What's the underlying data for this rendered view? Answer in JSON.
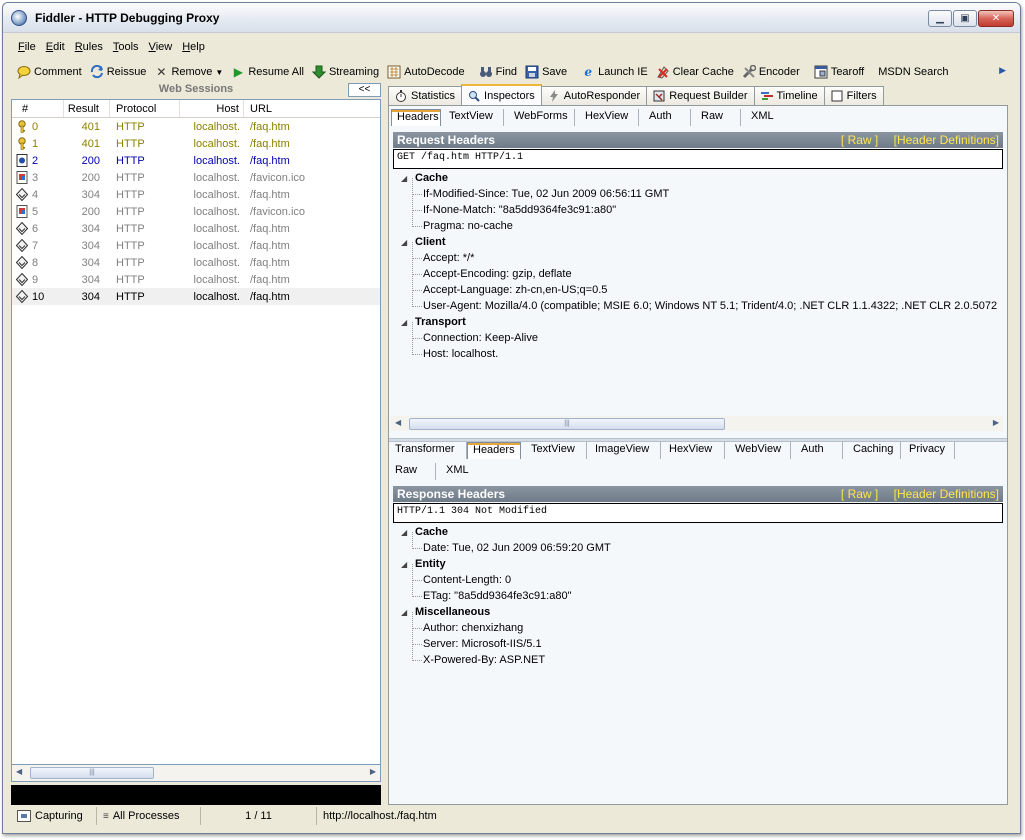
{
  "window": {
    "title": "Fiddler - HTTP Debugging Proxy"
  },
  "menu": [
    {
      "letter": "F",
      "rest": "ile"
    },
    {
      "letter": "E",
      "rest": "dit"
    },
    {
      "letter": "R",
      "rest": "ules"
    },
    {
      "letter": "T",
      "rest": "ools"
    },
    {
      "letter": "V",
      "rest": "iew"
    },
    {
      "letter": "H",
      "rest": "elp"
    }
  ],
  "toolbar": {
    "comment": "Comment",
    "reissue": "Reissue",
    "remove": "Remove",
    "resume_all": "Resume All",
    "streaming": "Streaming",
    "autodecode": "AutoDecode",
    "find": "Find",
    "save": "Save",
    "launch_ie": "Launch IE",
    "clear_cache": "Clear Cache",
    "encoder": "Encoder",
    "tearoff": "Tearoff",
    "msdn_search": "MSDN Search"
  },
  "sessions": {
    "title": "Web Sessions",
    "collapse_label": "<<",
    "columns": {
      "num": "#",
      "result": "Result",
      "protocol": "Protocol",
      "host": "Host",
      "url": "URL"
    },
    "rows": [
      {
        "num": "0",
        "result": "401",
        "protocol": "HTTP",
        "host": "localhost.",
        "url": "/faq.htm",
        "icon": "key-icon",
        "color": "#8b8000"
      },
      {
        "num": "1",
        "result": "401",
        "protocol": "HTTP",
        "host": "localhost.",
        "url": "/faq.htm",
        "icon": "key-icon",
        "color": "#8b8000"
      },
      {
        "num": "2",
        "result": "200",
        "protocol": "HTTP",
        "host": "localhost.",
        "url": "/faq.htm",
        "icon": "page-icon",
        "color": "#0000b0"
      },
      {
        "num": "3",
        "result": "200",
        "protocol": "HTTP",
        "host": "localhost.",
        "url": "/favicon.ico",
        "icon": "image-icon",
        "color": "#808080"
      },
      {
        "num": "4",
        "result": "304",
        "protocol": "HTTP",
        "host": "localhost.",
        "url": "/faq.htm",
        "icon": "diamond-icon",
        "color": "#808080"
      },
      {
        "num": "5",
        "result": "200",
        "protocol": "HTTP",
        "host": "localhost.",
        "url": "/favicon.ico",
        "icon": "image-icon",
        "color": "#808080"
      },
      {
        "num": "6",
        "result": "304",
        "protocol": "HTTP",
        "host": "localhost.",
        "url": "/faq.htm",
        "icon": "diamond-icon",
        "color": "#808080"
      },
      {
        "num": "7",
        "result": "304",
        "protocol": "HTTP",
        "host": "localhost.",
        "url": "/faq.htm",
        "icon": "diamond-icon",
        "color": "#808080"
      },
      {
        "num": "8",
        "result": "304",
        "protocol": "HTTP",
        "host": "localhost.",
        "url": "/faq.htm",
        "icon": "diamond-icon",
        "color": "#808080"
      },
      {
        "num": "9",
        "result": "304",
        "protocol": "HTTP",
        "host": "localhost.",
        "url": "/faq.htm",
        "icon": "diamond-icon",
        "color": "#808080"
      },
      {
        "num": "10",
        "result": "304",
        "protocol": "HTTP",
        "host": "localhost.",
        "url": "/faq.htm",
        "icon": "diamond-icon",
        "color": "#000000",
        "selected": true
      }
    ]
  },
  "main_tabs": [
    {
      "label": "Statistics",
      "icon": "stopwatch-icon"
    },
    {
      "label": "Inspectors",
      "icon": "magnifier-icon",
      "active": true
    },
    {
      "label": "AutoResponder",
      "icon": "lightning-icon"
    },
    {
      "label": "Request Builder",
      "icon": "builder-icon"
    },
    {
      "label": "Timeline",
      "icon": "timeline-icon"
    },
    {
      "label": "Filters",
      "icon": "checkbox-icon"
    }
  ],
  "request": {
    "tabs": [
      "Headers",
      "TextView",
      "WebForms",
      "HexView",
      "Auth",
      "Raw",
      "XML"
    ],
    "active_tab": "Headers",
    "header_title": "Request Headers",
    "raw_link": "[ Raw ]",
    "defs_link": "[Header Definitions]",
    "request_line": "GET /faq.htm HTTP/1.1",
    "groups": [
      {
        "name": "Cache",
        "items": [
          "If-Modified-Since: Tue, 02 Jun 2009 06:56:11 GMT",
          "If-None-Match: \"8a5dd9364fe3c91:a80\"",
          "Pragma: no-cache"
        ]
      },
      {
        "name": "Client",
        "items": [
          "Accept: */*",
          "Accept-Encoding: gzip, deflate",
          "Accept-Language: zh-cn,en-US;q=0.5",
          "User-Agent: Mozilla/4.0 (compatible; MSIE 6.0; Windows NT 5.1; Trident/4.0; .NET CLR 1.1.4322; .NET CLR 2.0.5072"
        ]
      },
      {
        "name": "Transport",
        "items": [
          "Connection: Keep-Alive",
          "Host: localhost."
        ]
      }
    ]
  },
  "response": {
    "tabs_row1": [
      "Transformer",
      "Headers",
      "TextView",
      "ImageView",
      "HexView",
      "WebView",
      "Auth",
      "Caching",
      "Privacy"
    ],
    "tabs_row2": [
      "Raw",
      "XML"
    ],
    "active_tab": "Headers",
    "header_title": "Response Headers",
    "raw_link": "[ Raw ]",
    "defs_link": "[Header Definitions]",
    "status_line": "HTTP/1.1 304 Not Modified",
    "groups": [
      {
        "name": "Cache",
        "items": [
          "Date: Tue, 02 Jun 2009 06:59:20 GMT"
        ]
      },
      {
        "name": "Entity",
        "items": [
          "Content-Length: 0",
          "ETag: \"8a5dd9364fe3c91:a80\""
        ]
      },
      {
        "name": "Miscellaneous",
        "items": [
          "Author: chenxizhang",
          "Server: Microsoft-IIS/5.1",
          "X-Powered-By: ASP.NET"
        ]
      }
    ]
  },
  "status": {
    "capturing": "Capturing",
    "processes": "All Processes",
    "count": "1 / 11",
    "url": "http://localhost./faq.htm"
  }
}
